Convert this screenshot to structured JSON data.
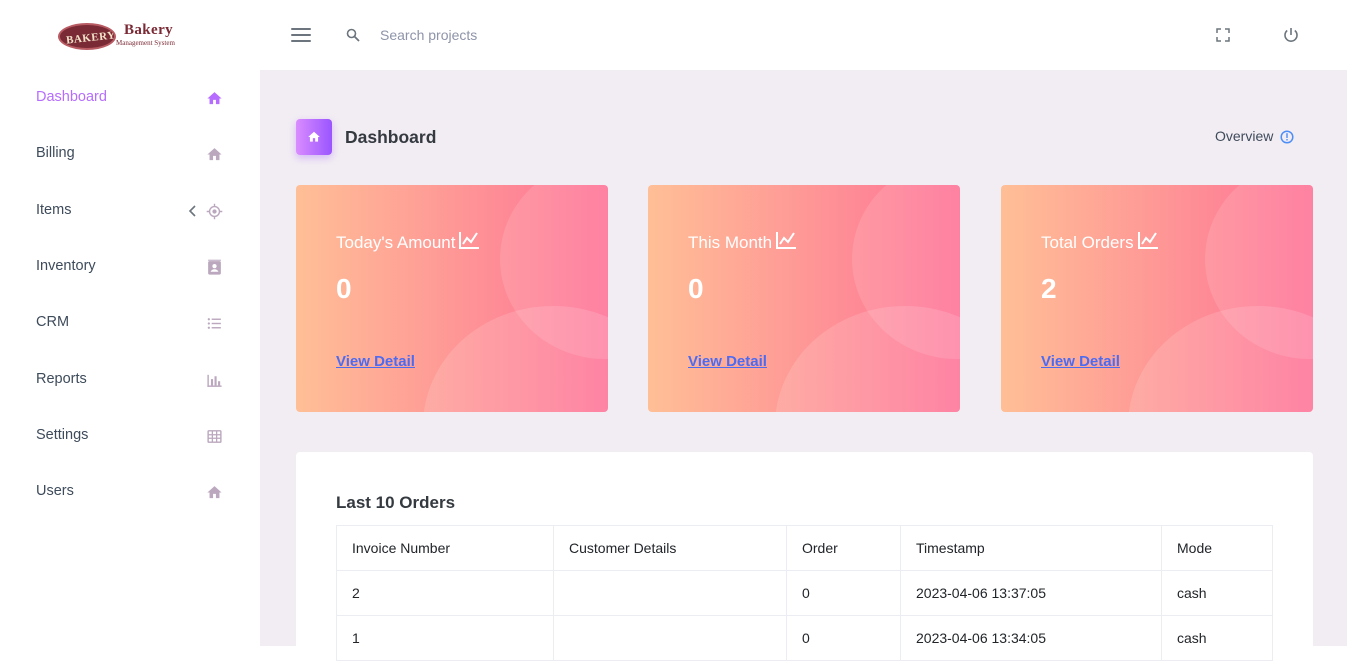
{
  "brand": {
    "badge_text": "BAKERY",
    "title": "Bakery",
    "subtitle": "Management System"
  },
  "header": {
    "search_placeholder": "Search projects"
  },
  "sidebar": {
    "items": [
      {
        "label": "Dashboard",
        "icon": "home-icon",
        "active": true
      },
      {
        "label": "Billing",
        "icon": "home-icon"
      },
      {
        "label": "Items",
        "icon": "crosshairs-icon",
        "has_submenu": true
      },
      {
        "label": "Inventory",
        "icon": "contacts-icon"
      },
      {
        "label": "CRM",
        "icon": "format-list-bulleted-icon"
      },
      {
        "label": "Reports",
        "icon": "chart-bar-icon"
      },
      {
        "label": "Settings",
        "icon": "table-large-icon"
      },
      {
        "label": "Users",
        "icon": "home-icon"
      }
    ]
  },
  "page": {
    "title": "Dashboard",
    "overview_label": "Overview"
  },
  "cards": [
    {
      "title": "Today's Amount",
      "value": "0",
      "link": "View Detail"
    },
    {
      "title": "This Month",
      "value": "0",
      "link": "View Detail"
    },
    {
      "title": "Total Orders",
      "value": "2",
      "link": "View Detail"
    }
  ],
  "orders": {
    "title": "Last 10 Orders",
    "columns": [
      "Invoice Number",
      "Customer Details",
      "Order",
      "Timestamp",
      "Mode"
    ],
    "rows": [
      [
        "2",
        "",
        "0",
        "2023-04-06 13:37:05",
        "cash"
      ],
      [
        "1",
        "",
        "0",
        "2023-04-06 13:34:05",
        "cash"
      ]
    ]
  },
  "colors": {
    "accent": "#b66dff",
    "card_gradient_start": "#ffbf96",
    "card_gradient_end": "#fe7096",
    "link": "#4d6bf1",
    "background": "#f2edf3"
  }
}
